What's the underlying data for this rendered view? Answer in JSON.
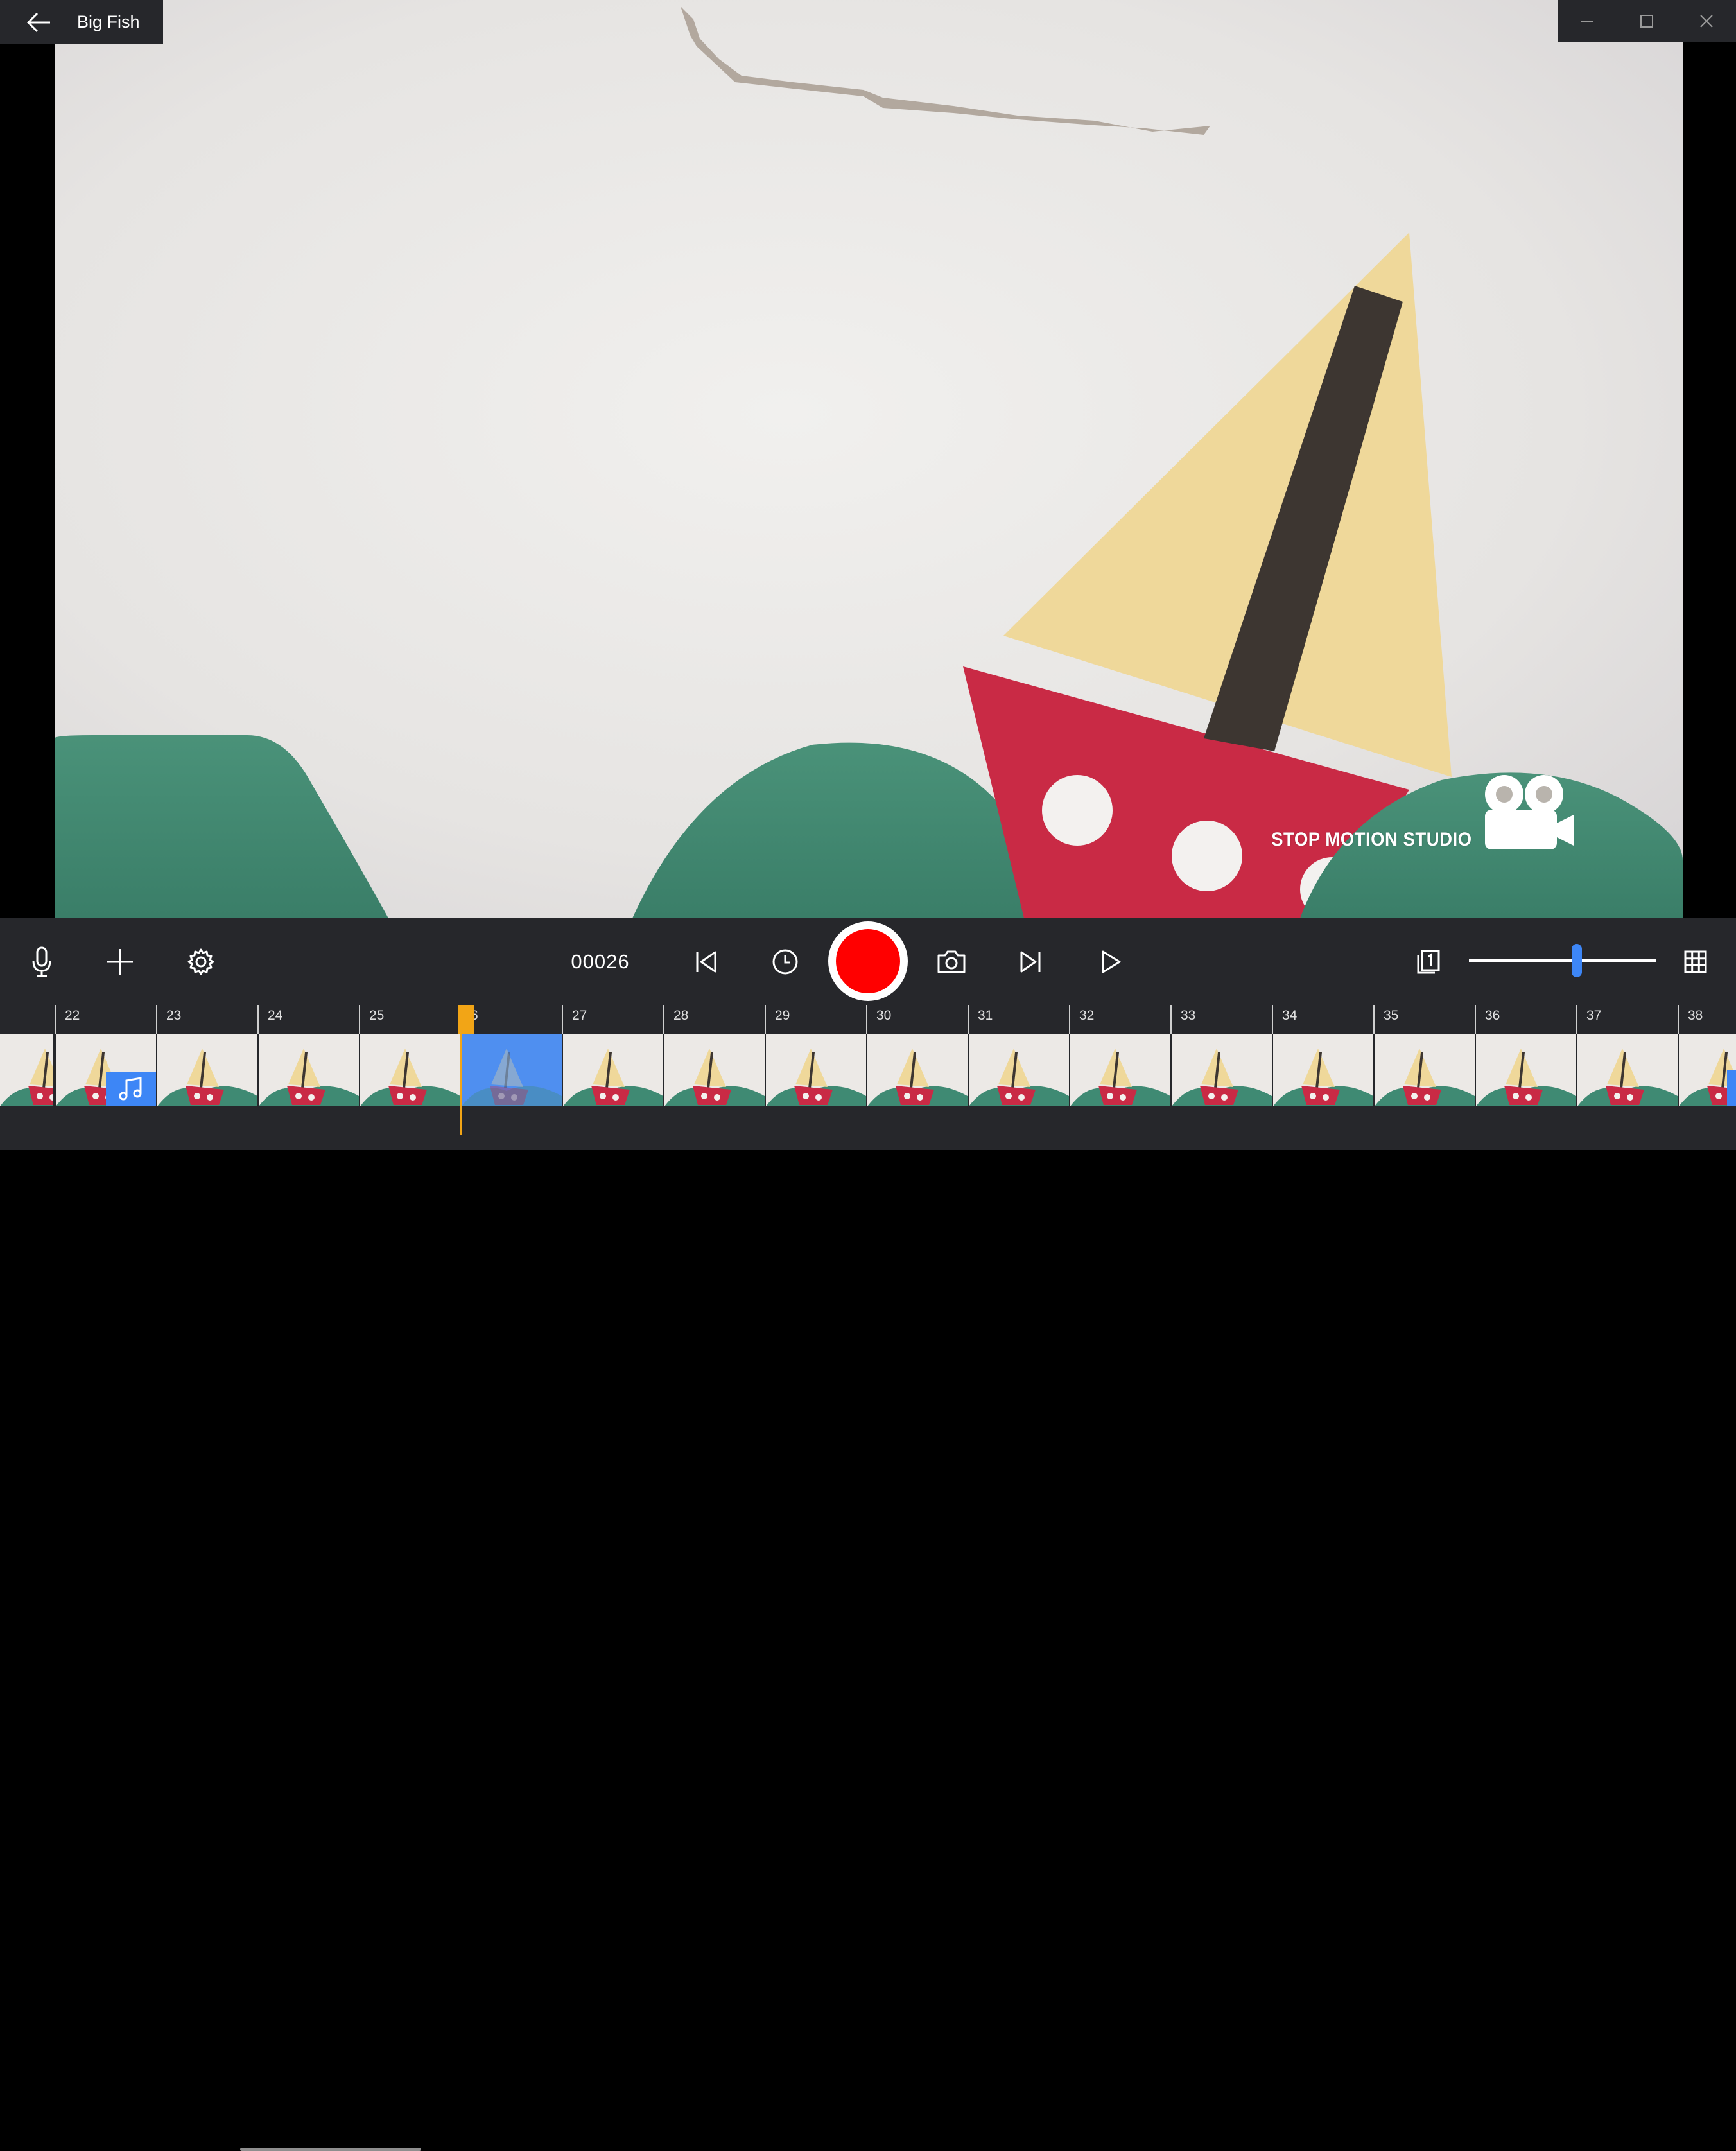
{
  "app": {
    "title": "Big Fish"
  },
  "window_controls": [
    "minimize-icon",
    "maximize-icon",
    "close-icon"
  ],
  "viewer": {
    "watermark": "STOP MOTION STUDIO"
  },
  "toolbar": {
    "left_icons": [
      "microphone-icon",
      "plus-icon",
      "gear-icon"
    ],
    "frame_counter": "00026",
    "center_icons": [
      "skip-to-start-icon",
      "clock-icon",
      "record-icon",
      "camera-icon",
      "skip-to-end-icon",
      "play-icon"
    ],
    "right_icons": [
      "onion-skin-frames-icon",
      "grid-icon"
    ],
    "onion_skin_level": 0.58
  },
  "timeline": {
    "frame_labels": [
      "22",
      "23",
      "24",
      "25",
      "6",
      "27",
      "28",
      "29",
      "30",
      "31",
      "32",
      "33",
      "34",
      "35",
      "36",
      "37",
      "38"
    ],
    "current_frame_index": 4
  },
  "colors": {
    "bar_bg": "#26272b",
    "record": "#ff0000",
    "accent_blue": "#3d86f6",
    "playhead": "#f2a516",
    "sail": "#efd89a",
    "hull": "#c92a45",
    "wave": "#3f8a73",
    "paper": "#e9e7e4"
  }
}
